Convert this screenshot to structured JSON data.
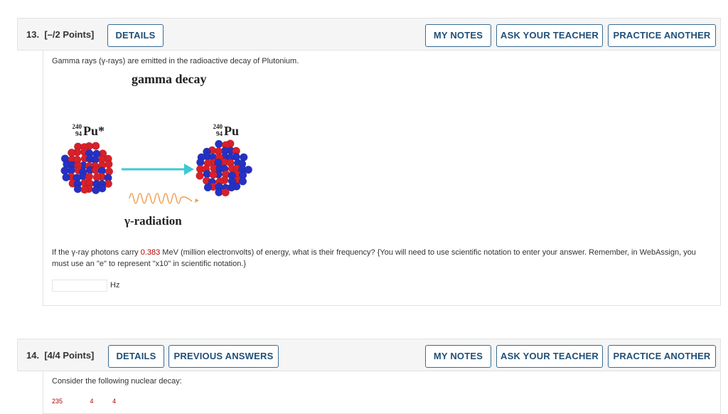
{
  "q13": {
    "number": "13.",
    "points": "[–/2 Points]",
    "details_button": "DETAILS",
    "my_notes_button": "MY NOTES",
    "ask_teacher_button": "ASK YOUR TEACHER",
    "practice_button": "PRACTICE ANOTHER",
    "intro_text": "Gamma rays (γ-rays) are emitted in the radioactive decay of Plutonium.",
    "figure": {
      "title": "gamma decay",
      "left_nucleus": {
        "mass": "240",
        "atomic": "94",
        "symbol": "Pu*"
      },
      "right_nucleus": {
        "mass": "240",
        "atomic": "94",
        "symbol": "Pu"
      },
      "radiation_label": "γ-radiation",
      "colors": {
        "proton": "#d8202a",
        "neutron": "#2531c4",
        "arrow": "#3cc9d6",
        "wave": "#f0a050"
      }
    },
    "question_part1": "If the γ-ray photons carry ",
    "energy_value": "0.383",
    "question_part2": " MeV (million electronvolts) of energy, what is their frequency? {You will need to use scientific notation to enter your answer. Remember, in WebAssign, you must use an \"e\" to represent \"x10\" in scientific notation.}",
    "answer_value": "",
    "answer_unit": "Hz"
  },
  "q14": {
    "number": "14.",
    "points": "[4/4 Points]",
    "details_button": "DETAILS",
    "previous_button": "PREVIOUS ANSWERS",
    "my_notes_button": "MY NOTES",
    "ask_teacher_button": "ASK YOUR TEACHER",
    "practice_button": "PRACTICE ANOTHER",
    "intro_text": "Consider the following nuclear decay:",
    "partial_values": [
      "235",
      "4",
      "4"
    ]
  }
}
